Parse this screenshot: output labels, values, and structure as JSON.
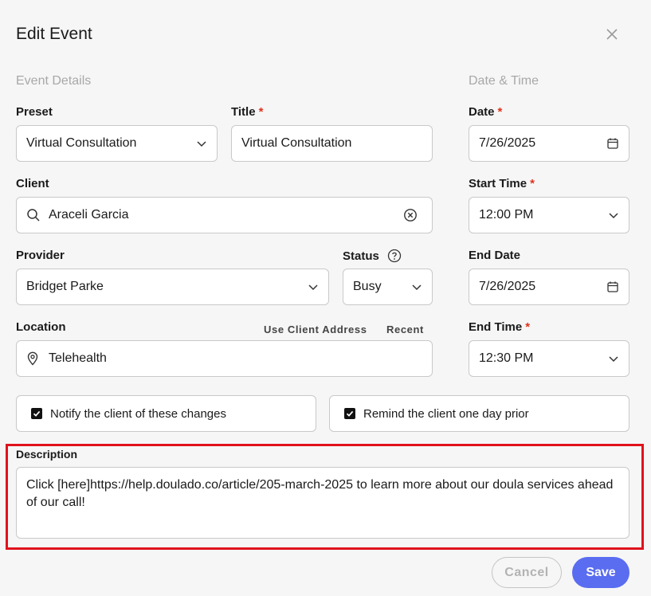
{
  "header": {
    "title": "Edit Event"
  },
  "sections": {
    "event_details": "Event Details",
    "date_time": "Date & Time"
  },
  "preset": {
    "label": "Preset",
    "value": "Virtual Consultation"
  },
  "title_field": {
    "label": "Title",
    "required": "*",
    "value": "Virtual Consultation"
  },
  "date": {
    "label": "Date",
    "required": "*",
    "value": "7/26/2025"
  },
  "client": {
    "label": "Client",
    "value": "Araceli Garcia"
  },
  "start_time": {
    "label": "Start Time",
    "required": "*",
    "value": "12:00 PM"
  },
  "provider": {
    "label": "Provider",
    "value": "Bridget Parke"
  },
  "status": {
    "label": "Status",
    "value": "Busy"
  },
  "end_date": {
    "label": "End Date",
    "value": "7/26/2025"
  },
  "location": {
    "label": "Location",
    "use_client_address": "Use Client Address",
    "recent": "Recent",
    "value": "Telehealth"
  },
  "end_time": {
    "label": "End Time",
    "required": "*",
    "value": "12:30 PM"
  },
  "notify": {
    "label": "Notify the client of these changes",
    "checked": true
  },
  "remind": {
    "label": "Remind the client one day prior",
    "checked": true
  },
  "description": {
    "label": "Description",
    "value": "Click [here]https://help.doulado.co/article/205-march-2025 to learn more about our doula services ahead of our call!"
  },
  "footer": {
    "cancel": "Cancel",
    "save": "Save"
  },
  "colors": {
    "accent": "#5a6cf0",
    "required": "#e0321c",
    "highlight": "#e0121c"
  }
}
